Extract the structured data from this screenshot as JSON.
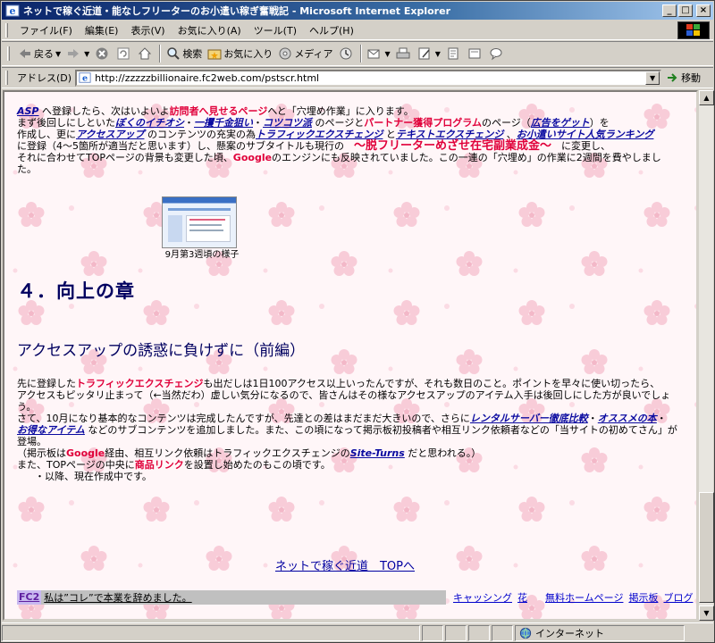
{
  "window": {
    "title": "ネットで稼ぐ近道・能なしフリーターのお小遣い稼ぎ奮戦記 - Microsoft Internet Explorer",
    "buttons": {
      "minimize": "_",
      "maximize": "□",
      "close": "×"
    }
  },
  "menu": [
    "ファイル(F)",
    "編集(E)",
    "表示(V)",
    "お気に入り(A)",
    "ツール(T)",
    "ヘルプ(H)"
  ],
  "toolbar": {
    "back": "戻る",
    "search": "検索",
    "favorites": "お気に入り",
    "media": "メディア"
  },
  "address": {
    "label": "アドレス(D)",
    "url": "http://zzzzzbillionaire.fc2web.com/pstscr.html",
    "go": "移動"
  },
  "content": {
    "p1": {
      "asp": "ASP",
      "t1": " へ登録したら、次はいよいよ",
      "visitor_page": "訪問者へ見せるページ",
      "t2": "へと「穴埋め作業」に入ります。"
    },
    "p2": {
      "t1": "まず後回しにしといた",
      "recommend": "ぼくのイチオシ",
      "dot1": "・",
      "one_shot": "一攫千金狙い",
      "dot2": "・",
      "steady": "コツコツ派",
      "t2": " のページと",
      "partner": "パートナー獲得プログラム",
      "t3": "のページ（",
      "ad": "広告をゲット",
      "t4": "）を"
    },
    "p3": {
      "t1": "作成し、更に",
      "access_up": "アクセスアップ",
      "t2": " のコンテンツの充実の為",
      "traffic": "トラフィックエクスチェンジ",
      "t3": " と",
      "text_exchange": "テキストエクスチェンジ",
      "t4": " 、",
      "ranking": "お小遣いサイト人気ランキング"
    },
    "p4": {
      "t1": "に登録（4～5箇所が適当だと思います）し、懸案のサブタイトルも現行の　",
      "subtitle": "～脱フリーターめざせ在宅副業成金～",
      "t2": "　に変更し、"
    },
    "p5": {
      "t1": "それに合わせてTOPページの背景も変更した頃、",
      "google": "Google",
      "t2": "のエンジンにも反映されていました。この一連の「穴埋め」の作業に2週間を費やしました。"
    },
    "thumb_caption": "9月第3週頃の様子",
    "section_title": "４．向上の章",
    "subsection_title": "アクセスアップの誘惑に負けずに（前編）",
    "q1": {
      "t1": "先に登録した",
      "traffic": "トラフィックエクスチェンジ",
      "t2": "も出だしは1日100アクセス以上いったんですが、それも数日のこと。ポイントを早々に使い切ったら、"
    },
    "q2": "アクセスもピッタリ止まって（←当然だわ）虚しい気分になるので、皆さんはその様なアクセスアップのアイテム入手は後回しにした方が良いでしょう。",
    "q3": {
      "t1": "さて、10月になり基本的なコンテンツは完成したんですが、先達との差はまだまだ大きいので、さらに",
      "rental": "レンタルサーバー徹底比較",
      "dot": "・",
      "osusume": "オススメの本",
      "dot2": "・"
    },
    "q4": {
      "bargain": "お得なアイテム",
      "t1": " などのサブコンテンツを追加しました。また、この頃になって掲示板初投稿者や相互リンク依頼者などの「当サイトの初めてさん」が登場。"
    },
    "q5": {
      "t1": "（掲示板は",
      "google": "Google",
      "t2": "経由、相互リンク依頼はトラフィックエクスチェンジの",
      "site_turns": "Site-Turns",
      "t3": " だと思われる。）"
    },
    "q6": {
      "t1": "また、TOPページの中央に",
      "shop_link": "商品リンク",
      "t2": "を設置し始めたのもこの頃です。"
    },
    "q7": "・以降、現在作成中です。",
    "top_link": "ネットで稼ぐ近道　TOPへ"
  },
  "fc2_bar": {
    "logo": "FC2",
    "ad_text": "私は”コレ”で本業を辞めました。",
    "links": [
      "キャッシング",
      "花",
      "無料ホームページ",
      "掲示板",
      "ブログ"
    ]
  },
  "status": {
    "zone": "インターネット"
  },
  "colors": {
    "accent_red": "#e0003a",
    "link_blue": "#0a0aa0",
    "heading": "#000060",
    "page_bg": "#fff5f7",
    "blossom": "#f7c7d3"
  }
}
